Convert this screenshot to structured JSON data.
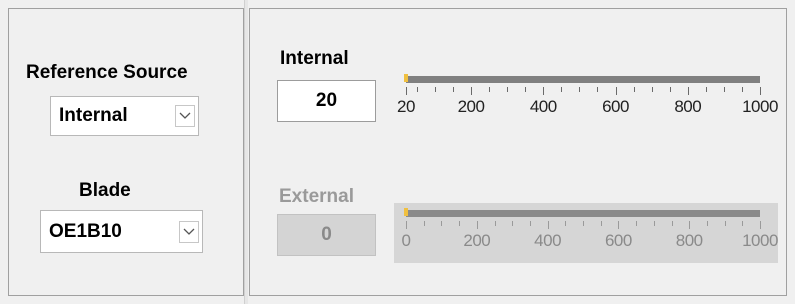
{
  "left": {
    "reference_source_label": "Reference Source",
    "reference_source_value": "Internal",
    "blade_label": "Blade",
    "blade_value": "OE1B10"
  },
  "internal": {
    "label": "Internal",
    "value": "20",
    "slider_min": 20,
    "slider_max": 1000,
    "slider_value": 20,
    "tick_labels": [
      "20",
      "200",
      "400",
      "600",
      "800",
      "1000"
    ],
    "tick_values": [
      20,
      200,
      400,
      600,
      800,
      1000
    ]
  },
  "external": {
    "label": "External",
    "value": "0",
    "slider_min": 0,
    "slider_max": 1000,
    "slider_value": 0,
    "tick_labels": [
      "0",
      "200",
      "400",
      "600",
      "800",
      "1000"
    ],
    "tick_values": [
      0,
      200,
      400,
      600,
      800,
      1000
    ]
  },
  "icons": {
    "dropdown": "chevron-down-icon"
  },
  "colors": {
    "thumb": "#f0c040",
    "track": "#808080",
    "disabled_text": "#9a9a9a"
  }
}
